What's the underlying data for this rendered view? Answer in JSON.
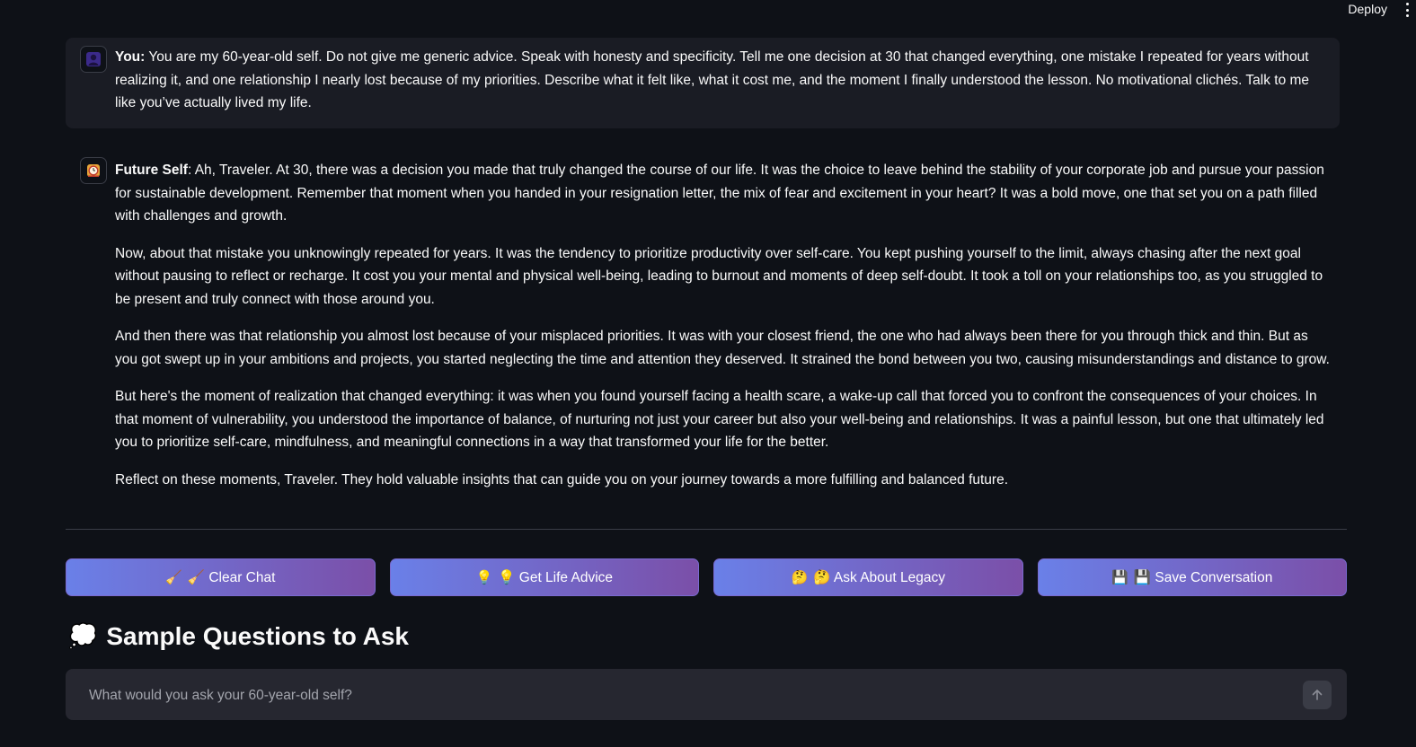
{
  "header": {
    "deploy_label": "Deploy",
    "menu_icon": "kebab-menu-icon"
  },
  "messages": [
    {
      "role": "user",
      "avatar_icon": "user-avatar-icon",
      "speaker": "You",
      "paragraphs": [
        "You are my 60-year-old self. Do not give me generic advice. Speak with honesty and specificity. Tell me one decision at 30 that changed everything, one mistake I repeated for years without realizing it, and one relationship I nearly lost because of my priorities. Describe what it felt like, what it cost me, and the moment I finally understood the lesson. No motivational clichés. Talk to me like you’ve actually lived my life."
      ]
    },
    {
      "role": "assistant",
      "avatar_icon": "alarm-clock-avatar-icon",
      "speaker": "Future Self",
      "paragraphs": [
        "Ah, Traveler. At 30, there was a decision you made that truly changed the course of our life. It was the choice to leave behind the stability of your corporate job and pursue your passion for sustainable development. Remember that moment when you handed in your resignation letter, the mix of fear and excitement in your heart? It was a bold move, one that set you on a path filled with challenges and growth.",
        "Now, about that mistake you unknowingly repeated for years. It was the tendency to prioritize productivity over self-care. You kept pushing yourself to the limit, always chasing after the next goal without pausing to reflect or recharge. It cost you your mental and physical well-being, leading to burnout and moments of deep self-doubt. It took a toll on your relationships too, as you struggled to be present and truly connect with those around you.",
        "And then there was that relationship you almost lost because of your misplaced priorities. It was with your closest friend, the one who had always been there for you through thick and thin. But as you got swept up in your ambitions and projects, you started neglecting the time and attention they deserved. It strained the bond between you two, causing misunderstandings and distance to grow.",
        "But here's the moment of realization that changed everything: it was when you found yourself facing a health scare, a wake-up call that forced you to confront the consequences of your choices. In that moment of vulnerability, you understood the importance of balance, of nurturing not just your career but also your well-being and relationships. It was a painful lesson, but one that ultimately led you to prioritize self-care, mindfulness, and meaningful connections in a way that transformed your life for the better.",
        "Reflect on these moments, Traveler. They hold valuable insights that can guide you on your journey towards a more fulfilling and balanced future."
      ]
    }
  ],
  "actions": [
    {
      "name": "clear-chat-button",
      "icon": "broom-icon",
      "emoji": "🧹",
      "label": "🧹 Clear Chat"
    },
    {
      "name": "get-life-advice-button",
      "icon": "light-bulb-icon",
      "emoji": "💡",
      "label": "💡 Get Life Advice"
    },
    {
      "name": "ask-about-legacy-button",
      "icon": "thinking-face-icon",
      "emoji": "🤔",
      "label": "🤔 Ask About Legacy"
    },
    {
      "name": "save-conversation-button",
      "icon": "floppy-disk-icon",
      "emoji": "💾",
      "label": "💾 Save Conversation"
    }
  ],
  "sample_questions": {
    "icon": "thought-balloon-icon",
    "emoji": "💭",
    "title": "Sample Questions to Ask"
  },
  "chat_input": {
    "placeholder": "What would you ask your 60-year-old self?",
    "send_icon": "arrow-up-icon"
  },
  "colors": {
    "background": "#0e1117",
    "user_message_bg": "#1a1c24",
    "button_gradient_start": "#6a80e8",
    "button_gradient_end": "#7b4fa8",
    "input_bg": "#262730"
  }
}
